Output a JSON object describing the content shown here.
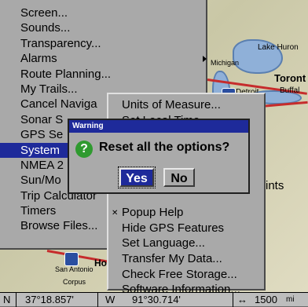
{
  "map": {
    "labels": {
      "lake_huron": "Lake Huron",
      "michigan": "Michigan",
      "toronto": "Toront",
      "buffalo": "Buffal",
      "detroit": "Detroit",
      "san_antonio": "San Antonio",
      "corpus": "Corpus",
      "ho": "Ho",
      "waypoints": "ints"
    }
  },
  "main_menu": {
    "items": [
      {
        "label": "Screen..."
      },
      {
        "label": "Sounds..."
      },
      {
        "label": "Transparency..."
      },
      {
        "label": "Alarms"
      },
      {
        "label": "Route Planning..."
      },
      {
        "label": "My Trails..."
      },
      {
        "label": "Cancel Naviga"
      },
      {
        "label": "Sonar S"
      },
      {
        "label": "GPS Se"
      },
      {
        "label": "System"
      },
      {
        "label": "NMEA 2"
      },
      {
        "label": "Sun/Mo"
      },
      {
        "label": "Trip Calculator"
      },
      {
        "label": "Timers"
      },
      {
        "label": "Browse Files..."
      }
    ]
  },
  "sub_menu": {
    "items": [
      {
        "label": "Units of Measure..."
      },
      {
        "label": "Set Local Time..."
      },
      {
        "label": ""
      },
      {
        "label": ""
      },
      {
        "label": ""
      },
      {
        "label": ""
      },
      {
        "label": ""
      },
      {
        "label": "Popup Help"
      },
      {
        "label": "Hide GPS Features"
      },
      {
        "label": "Set Language..."
      },
      {
        "label": "Transfer My Data..."
      },
      {
        "label": "Check Free Storage..."
      },
      {
        "label": "Software Information..."
      }
    ]
  },
  "dialog": {
    "title": "Warning",
    "message": "Reset all the options?",
    "yes_label": "Yes",
    "no_label": "No"
  },
  "status_bar": {
    "lat_hemi": "N",
    "lat": "37°18.857'",
    "lon_hemi": "W",
    "lon": "91°30.714'",
    "range_icon": "↔",
    "range": "1500",
    "range_unit": "mi"
  }
}
